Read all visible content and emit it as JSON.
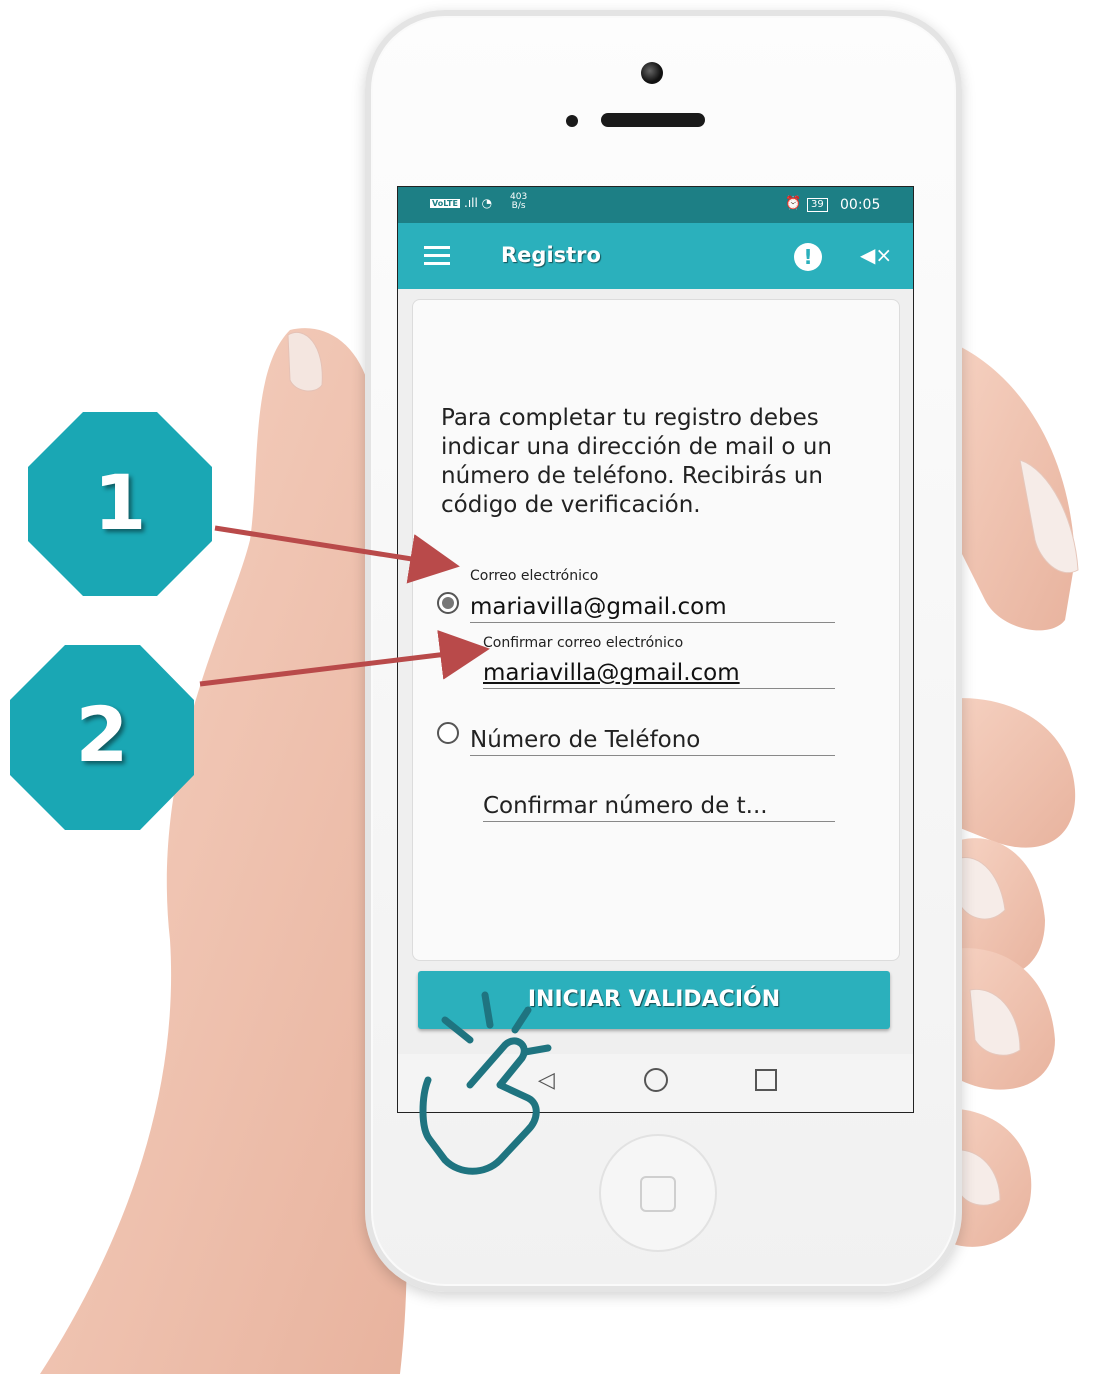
{
  "status_bar": {
    "network": "VoLTE",
    "signal": ".ıll",
    "speed_value": "403",
    "speed_unit": "B/s",
    "battery": "39",
    "time": "00:05"
  },
  "app_bar": {
    "title": "Registro",
    "menu_icon": "hamburger-menu-icon",
    "info_icon": "alert-circle-icon",
    "sound_icon": "volume-mute-icon"
  },
  "form": {
    "intro_text": "Para completar tu registro debes indicar una dirección de mail o un número de teléfono. Recibirás un código de verificación.",
    "email_label": "Correo electrónico",
    "email_value": "mariavilla@gmail.com",
    "email_selected": true,
    "confirm_email_label": "Confirmar correo electrónico",
    "confirm_email_value": "mariavilla@gmail.com",
    "phone_placeholder": "Número de Teléfono",
    "phone_selected": false,
    "confirm_phone_placeholder": "Confirmar número de t..."
  },
  "cta_label": "INICIAR VALIDACIÓN",
  "annotations": {
    "badge_1": "1",
    "badge_2": "2",
    "badge_color": "#1aa7b4",
    "arrow_color": "#b94a4a"
  },
  "colors": {
    "status_bar": "#1d7f85",
    "app_bar": "#2bb0bc",
    "cta": "#2bb0bc"
  }
}
